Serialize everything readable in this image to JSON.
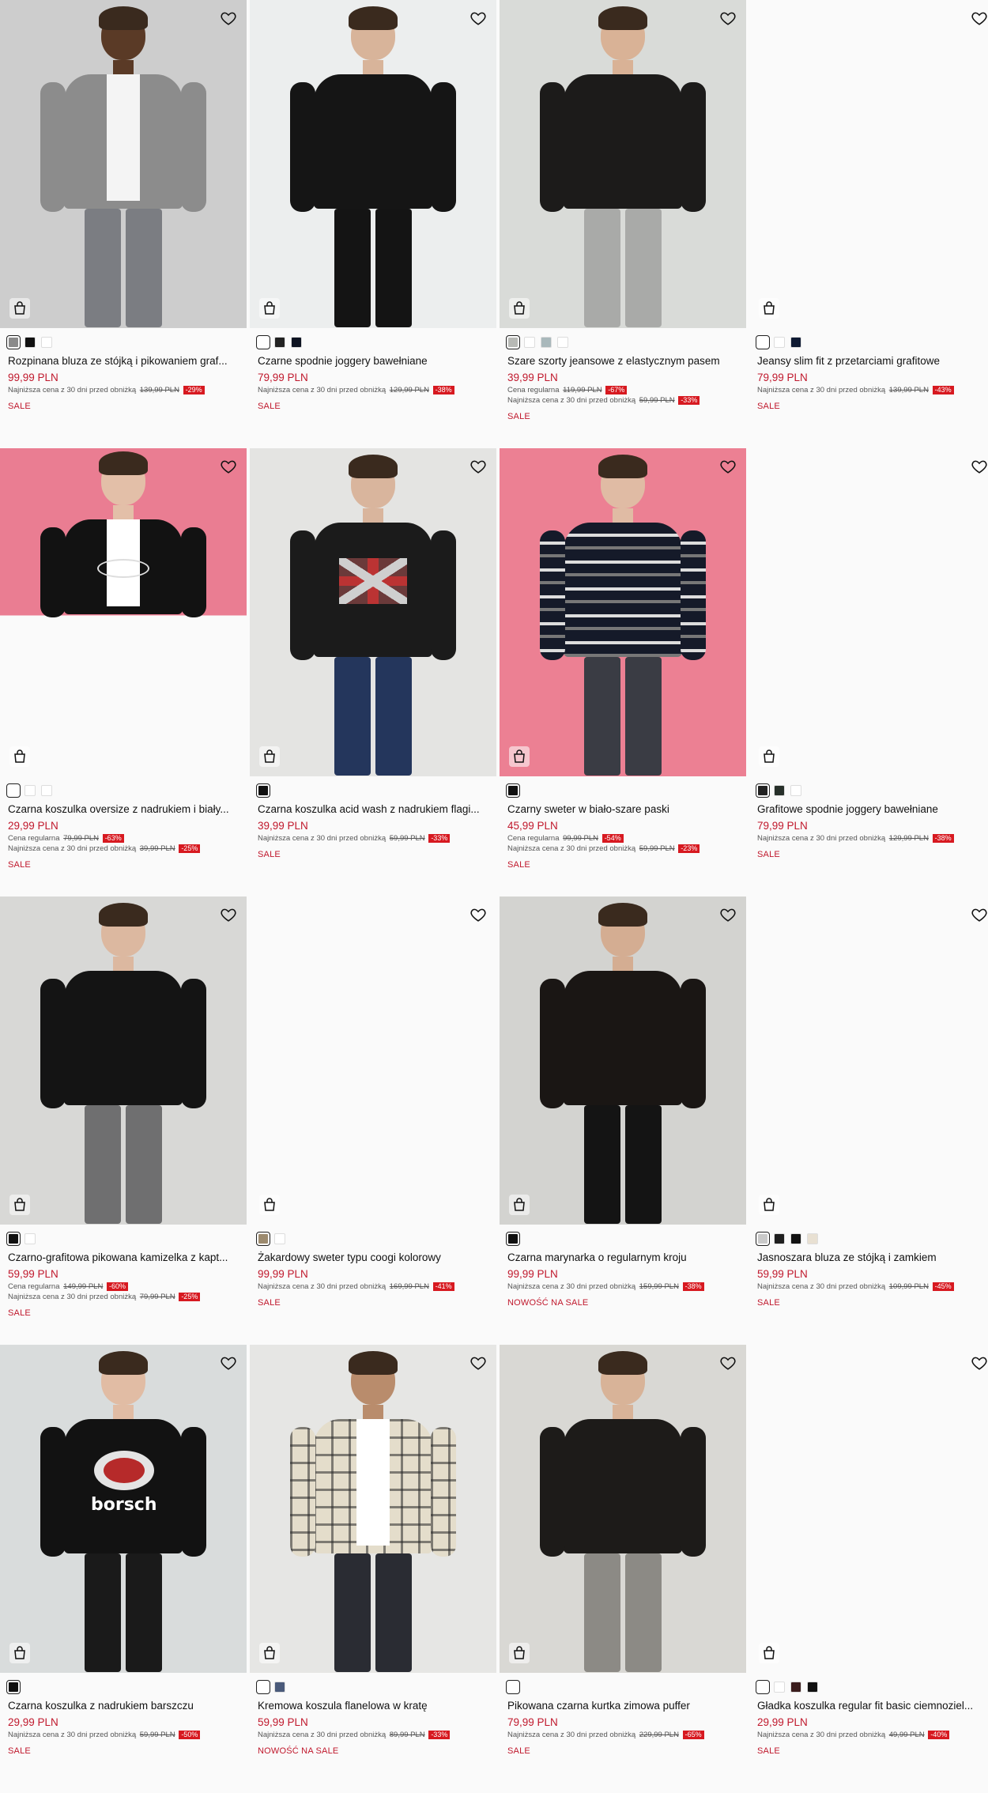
{
  "products": [
    {
      "name": "Rozpinana bluza ze stójką i pikowaniem graf...",
      "price": "99,99 PLN",
      "lines": [
        {
          "label": "Najniższa cena z 30 dni przed obniżką",
          "old": "139,99 PLN",
          "pct": "-29%"
        }
      ],
      "tag": "SALE",
      "swatches": [
        "#8a8a8a",
        "#111111",
        "#ffffff"
      ],
      "bg": "#cdcdcd",
      "skin": "#5a3a26",
      "top": "#8c8c8c",
      "inner": "#f4f4f4",
      "pants": "#7b7d82"
    },
    {
      "name": "Czarne spodnie joggery bawełniane",
      "price": "79,99 PLN",
      "lines": [
        {
          "label": "Najniższa cena z 30 dni przed obniżką",
          "old": "129,99 PLN",
          "pct": "-38%"
        }
      ],
      "tag": "SALE",
      "swatches": [
        "#ffffff",
        "#222222",
        "#0e1422"
      ],
      "bg": "#eceeee",
      "skin": "#d8b49a",
      "top": "#151515",
      "inner": "#151515",
      "pants": "#141414"
    },
    {
      "name": "Szare szorty jeansowe z elastycznym pasem",
      "price": "39,99 PLN",
      "lines": [
        {
          "label": "Cena regularna",
          "old": "119,99 PLN",
          "pct": "-67%"
        },
        {
          "label": "Najniższa cena z 30 dni przed obniżką",
          "old": "59,99 PLN",
          "pct": "-33%"
        }
      ],
      "tag": "SALE",
      "swatches": [
        "#b7b9b5",
        "#ffffff",
        "#a9b8bb",
        "#ffffff"
      ],
      "bg": "#d9dbd8",
      "skin": "#d9b296",
      "top": "#1c1b1a",
      "inner": "#1c1b1a",
      "pants": "#a9aaa8"
    },
    {
      "name": "Jeansy slim fit z przetarciami grafitowe",
      "price": "79,99 PLN",
      "lines": [
        {
          "label": "Najniższa cena z 30 dni przed obniżką",
          "old": "139,99 PLN",
          "pct": "-43%"
        }
      ],
      "tag": "SALE",
      "swatches": [
        "#ffffff",
        "#ffffff",
        "#0f1a33"
      ],
      "bg": "#fafafa",
      "skin": "",
      "top": "",
      "inner": "",
      "pants": ""
    },
    {
      "name": "Czarna koszulka oversize z nadrukiem i biały...",
      "price": "29,99 PLN",
      "lines": [
        {
          "label": "Cena regularna",
          "old": "79,99 PLN",
          "pct": "-63%"
        },
        {
          "label": "Najniższa cena z 30 dni przed obniżką",
          "old": "39,99 PLN",
          "pct": "-25%"
        }
      ],
      "tag": "SALE",
      "swatches": [
        "#ffffff",
        "#ffffff",
        "#ffffff"
      ],
      "bg": "#ea7d92",
      "skin": "#e3bfa8",
      "top": "#121212",
      "inner": "#ffffff",
      "pants": "",
      "half": true
    },
    {
      "name": "Czarna koszulka acid wash z nadrukiem flagi...",
      "price": "39,99 PLN",
      "lines": [
        {
          "label": "Najniższa cena z 30 dni przed obniżką",
          "old": "59,99 PLN",
          "pct": "-33%"
        }
      ],
      "tag": "SALE",
      "swatches": [
        "#111111"
      ],
      "bg": "#e4e4e2",
      "skin": "#d9b59d",
      "top": "#1b1b1b",
      "inner": "#1b1b1b",
      "pants": "#24365c",
      "flag": true
    },
    {
      "name": "Czarny sweter w biało-szare paski",
      "price": "45,99 PLN",
      "lines": [
        {
          "label": "Cena regularna",
          "old": "99,99 PLN",
          "pct": "-54%"
        },
        {
          "label": "Najniższa cena z 30 dni przed obniżką",
          "old": "59,99 PLN",
          "pct": "-23%"
        }
      ],
      "tag": "SALE",
      "swatches": [
        "#111111"
      ],
      "bg": "#ec8093",
      "skin": "#e0bba4",
      "top": "#151a29",
      "inner": "#151a29",
      "pants": "#3a3c44",
      "stripes": true
    },
    {
      "name": "Grafitowe spodnie joggery bawełniane",
      "price": "79,99 PLN",
      "lines": [
        {
          "label": "Najniższa cena z 30 dni przed obniżką",
          "old": "129,99 PLN",
          "pct": "-38%"
        }
      ],
      "tag": "SALE",
      "swatches": [
        "#222222",
        "#27302a",
        "#ffffff"
      ],
      "bg": "#fafafa",
      "skin": "",
      "top": "",
      "inner": "",
      "pants": ""
    },
    {
      "name": "Czarno-grafitowa pikowana kamizelka z kapt...",
      "price": "59,99 PLN",
      "lines": [
        {
          "label": "Cena regularna",
          "old": "149,99 PLN",
          "pct": "-60%"
        },
        {
          "label": "Najniższa cena z 30 dni przed obniżką",
          "old": "79,99 PLN",
          "pct": "-25%"
        }
      ],
      "tag": "SALE",
      "swatches": [
        "#111111",
        "#ffffff"
      ],
      "bg": "#d8d8d6",
      "skin": "#dcb8a0",
      "top": "#141414",
      "inner": "#141414",
      "pants": "#6f6f70"
    },
    {
      "name": "Żakardowy sweter typu coogi kolorowy",
      "price": "99,99 PLN",
      "lines": [
        {
          "label": "Najniższa cena z 30 dni przed obniżką",
          "old": "169,99 PLN",
          "pct": "-41%"
        }
      ],
      "tag": "SALE",
      "swatches": [
        "#9c8a6e",
        "#ffffff"
      ],
      "bg": "#fafafa",
      "skin": "",
      "top": "",
      "inner": "",
      "pants": ""
    },
    {
      "name": "Czarna marynarka o regularnym kroju",
      "price": "99,99 PLN",
      "lines": [
        {
          "label": "Najniższa cena z 30 dni przed obniżką",
          "old": "159,99 PLN",
          "pct": "-38%"
        }
      ],
      "tag": "NOWOŚĆ NA SALE",
      "swatches": [
        "#111111"
      ],
      "bg": "#d3d3d0",
      "skin": "#d4ad92",
      "top": "#1a1614",
      "inner": "#1a1614",
      "pants": "#141414"
    },
    {
      "name": "Jasnoszara bluza ze stójką i zamkiem",
      "price": "59,99 PLN",
      "lines": [
        {
          "label": "Najniższa cena z 30 dni przed obniżką",
          "old": "109,99 PLN",
          "pct": "-45%"
        }
      ],
      "tag": "SALE",
      "swatches": [
        "#c9c9c9",
        "#1f1f1f",
        "#111111",
        "#e8e0d2"
      ],
      "bg": "#fafafa",
      "skin": "",
      "top": "",
      "inner": "",
      "pants": ""
    },
    {
      "name": "Czarna koszulka z nadrukiem barszczu",
      "price": "29,99 PLN",
      "lines": [
        {
          "label": "Najniższa cena z 30 dni przed obniżką",
          "old": "59,99 PLN",
          "pct": "-50%"
        }
      ],
      "tag": "SALE",
      "swatches": [
        "#111111"
      ],
      "bg": "#d9dcdc",
      "skin": "#e1bca4",
      "top": "#121212",
      "inner": "#121212",
      "pants": "#1a1a1a",
      "borsch": true
    },
    {
      "name": "Kremowa koszula flanelowa w kratę",
      "price": "59,99 PLN",
      "lines": [
        {
          "label": "Najniższa cena z 30 dni przed obniżką",
          "old": "89,99 PLN",
          "pct": "-33%"
        }
      ],
      "tag": "NOWOŚĆ NA SALE",
      "swatches": [
        "#ffffff",
        "#4a5a7a"
      ],
      "bg": "#e6e6e4",
      "skin": "#b98c6c",
      "top": "#e4ddcb",
      "inner": "#ffffff",
      "pants": "#2a2c33",
      "plaid": true
    },
    {
      "name": "Pikowana czarna kurtka zimowa puffer",
      "price": "79,99 PLN",
      "lines": [
        {
          "label": "Najniższa cena z 30 dni przed obniżką",
          "old": "229,99 PLN",
          "pct": "-65%"
        }
      ],
      "tag": "SALE",
      "swatches": [
        "#ffffff"
      ],
      "bg": "#d9d8d4",
      "skin": "#d8b398",
      "top": "#1d1b19",
      "inner": "#1d1b19",
      "pants": "#8c8a85"
    },
    {
      "name": "Gładka koszulka regular fit basic ciemnoziel...",
      "price": "29,99 PLN",
      "lines": [
        {
          "label": "Najniższa cena z 30 dni przed obniżką",
          "old": "49,99 PLN",
          "pct": "-40%"
        }
      ],
      "tag": "SALE",
      "swatches": [
        "#ffffff",
        "#ffffff",
        "#3b1d1d",
        "#111111"
      ],
      "bg": "#fafafa",
      "skin": "",
      "top": "",
      "inner": "",
      "pants": ""
    }
  ],
  "icons": {
    "favorite": "heart-outline-icon",
    "cart": "shopping-bag-icon"
  },
  "colors": {
    "accent": "#c0182c",
    "badge": "#d71920"
  }
}
